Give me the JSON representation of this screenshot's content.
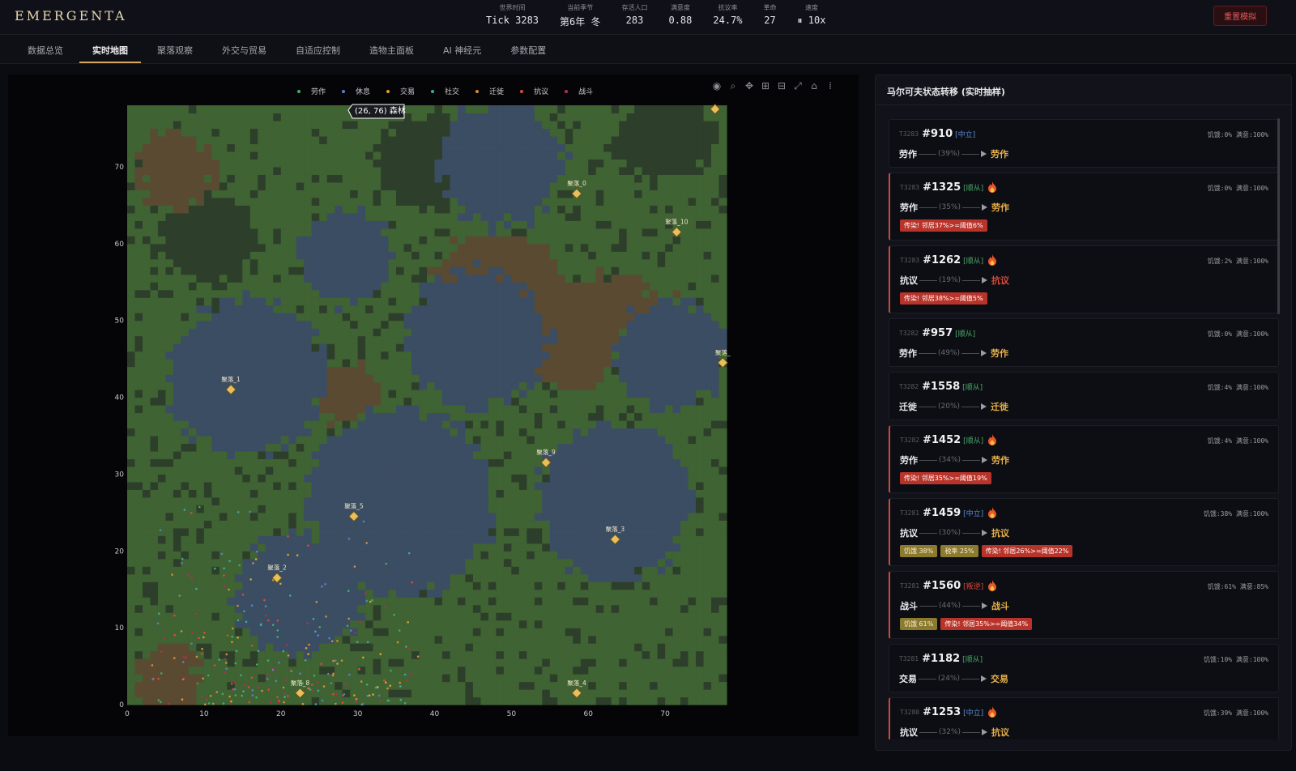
{
  "app": {
    "title": "EMERGENTA",
    "reset_label": "重置模拟"
  },
  "stats": [
    {
      "label": "世界时间",
      "value": "Tick 3283"
    },
    {
      "label": "当前季节",
      "value": "第6年 冬"
    },
    {
      "label": "存活人口",
      "value": "283"
    },
    {
      "label": "满意度",
      "value": "0.88"
    },
    {
      "label": "抗议率",
      "value": "24.7%"
    },
    {
      "label": "革命",
      "value": "27"
    },
    {
      "label": "速度",
      "value": "⏸ 10x"
    }
  ],
  "tabs": [
    {
      "label": "数据总览",
      "active": false
    },
    {
      "label": "实时地图",
      "active": true
    },
    {
      "label": "聚落观察",
      "active": false
    },
    {
      "label": "外交与贸易",
      "active": false
    },
    {
      "label": "自适应控制",
      "active": false
    },
    {
      "label": "造物主面板",
      "active": false
    },
    {
      "label": "AI 神经元",
      "active": false
    },
    {
      "label": "参数配置",
      "active": false
    }
  ],
  "legend": [
    {
      "label": "劳作",
      "color": "#3fae6a"
    },
    {
      "label": "休息",
      "color": "#5a7fc8"
    },
    {
      "label": "交易",
      "color": "#e0a030"
    },
    {
      "label": "社交",
      "color": "#3fa8a0"
    },
    {
      "label": "迁徙",
      "color": "#d88a3a"
    },
    {
      "label": "抗议",
      "color": "#d84a3a"
    },
    {
      "label": "战斗",
      "color": "#b03050"
    }
  ],
  "toolbar_icons": [
    "camera-icon",
    "zoom-icon",
    "pan-icon",
    "zoom-in-icon",
    "zoom-out-icon",
    "autoscale-icon",
    "reset-axes-icon",
    "plotly-logo-icon"
  ],
  "map": {
    "tooltip": "(26, 76) 森林",
    "x_ticks": [
      "0",
      "10",
      "20",
      "30",
      "40",
      "50",
      "60",
      "70"
    ],
    "y_ticks": [
      "0",
      "10",
      "20",
      "30",
      "40",
      "50",
      "60",
      "70"
    ],
    "colors": {
      "forest": "#3f6332",
      "water": "#3b4d63",
      "mountain": "#5a4a32",
      "dark": "#2d3f2a",
      "settlement": "#e8c05a"
    }
  },
  "chart_data": {
    "type": "scatter",
    "xlim": [
      0,
      78
    ],
    "ylim": [
      0,
      78
    ],
    "grid": false,
    "legend_position": "top",
    "x_ticks": [
      0,
      10,
      20,
      30,
      40,
      50,
      60,
      70
    ],
    "y_ticks": [
      0,
      10,
      20,
      30,
      40,
      50,
      60,
      70
    ],
    "series": [
      {
        "name": "聚落",
        "points": [
          {
            "label": "聚落_0",
            "x": 58.5,
            "y": 66.5
          },
          {
            "label": "聚落_1",
            "x": 13.5,
            "y": 41
          },
          {
            "label": "聚落_2",
            "x": 19.5,
            "y": 16.5
          },
          {
            "label": "聚落_3",
            "x": 63.5,
            "y": 21.5
          },
          {
            "label": "聚落_4",
            "x": 58.5,
            "y": 1.5
          },
          {
            "label": "聚落_5",
            "x": 29.5,
            "y": 24.5
          },
          {
            "label": "聚落_8",
            "x": 22.5,
            "y": 1.5
          },
          {
            "label": "聚落_9",
            "x": 54.5,
            "y": 31.5
          },
          {
            "label": "聚落_10",
            "x": 71.5,
            "y": 61.5
          },
          {
            "label": "聚落_",
            "x": 77.5,
            "y": 44.5
          },
          {
            "label": "",
            "x": 76.5,
            "y": 77.5
          }
        ]
      }
    ]
  },
  "panel": {
    "title": "马尔可夫状态转移 (实时抽样)"
  },
  "transitions": [
    {
      "tick": "T3283",
      "id": "#910",
      "alignment": "[中立]",
      "align_color": "#5b8fd9",
      "fire": false,
      "status": "饥饿:0% 满意:100%",
      "from": "劳作",
      "pct": "(39%)",
      "to": "劳作",
      "to_color": "#e8b04a",
      "tags": []
    },
    {
      "tick": "T3283",
      "id": "#1325",
      "alignment": "[顺从]",
      "align_color": "#4aa86a",
      "fire": true,
      "status": "饥饿:0% 满意:100%",
      "from": "劳作",
      "pct": "(35%)",
      "to": "劳作",
      "to_color": "#e8b04a",
      "tags": [
        {
          "text": "传染! 邻居37%>=阈值6%",
          "kind": "red"
        }
      ]
    },
    {
      "tick": "T3283",
      "id": "#1262",
      "alignment": "[顺从]",
      "align_color": "#4aa86a",
      "fire": true,
      "status": "饥饿:2% 满意:100%",
      "from": "抗议",
      "pct": "(19%)",
      "to": "抗议",
      "to_color": "#d84a3a",
      "tags": [
        {
          "text": "传染! 邻居38%>=阈值5%",
          "kind": "red"
        }
      ]
    },
    {
      "tick": "T3282",
      "id": "#957",
      "alignment": "[顺从]",
      "align_color": "#4aa86a",
      "fire": false,
      "status": "饥饿:0% 满意:100%",
      "from": "劳作",
      "pct": "(49%)",
      "to": "劳作",
      "to_color": "#e8b04a",
      "tags": []
    },
    {
      "tick": "T3282",
      "id": "#1558",
      "alignment": "[顺从]",
      "align_color": "#4aa86a",
      "fire": false,
      "status": "饥饿:4% 满意:100%",
      "from": "迁徙",
      "pct": "(20%)",
      "to": "迁徙",
      "to_color": "#e8b04a",
      "tags": []
    },
    {
      "tick": "T3282",
      "id": "#1452",
      "alignment": "[顺从]",
      "align_color": "#4aa86a",
      "fire": true,
      "status": "饥饿:4% 满意:100%",
      "from": "劳作",
      "pct": "(34%)",
      "to": "劳作",
      "to_color": "#e8b04a",
      "tags": [
        {
          "text": "传染! 邻居35%>=阈值19%",
          "kind": "red"
        }
      ]
    },
    {
      "tick": "T3281",
      "id": "#1459",
      "alignment": "[中立]",
      "align_color": "#5b8fd9",
      "fire": true,
      "status": "饥饿:38% 满意:100%",
      "from": "抗议",
      "pct": "(30%)",
      "to": "抗议",
      "to_color": "#e8b04a",
      "tags": [
        {
          "text": "饥饿 38%",
          "kind": "olive"
        },
        {
          "text": "税率 25%",
          "kind": "olive"
        },
        {
          "text": "传染! 邻居26%>=阈值22%",
          "kind": "red"
        }
      ]
    },
    {
      "tick": "T3281",
      "id": "#1560",
      "alignment": "[叛逆]",
      "align_color": "#d84a3a",
      "fire": true,
      "status": "饥饿:61% 满意:85%",
      "from": "战斗",
      "pct": "(44%)",
      "to": "战斗",
      "to_color": "#e8b04a",
      "tags": [
        {
          "text": "饥饿 61%",
          "kind": "olive"
        },
        {
          "text": "传染! 邻居35%>=阈值34%",
          "kind": "red"
        }
      ]
    },
    {
      "tick": "T3281",
      "id": "#1182",
      "alignment": "[顺从]",
      "align_color": "#4aa86a",
      "fire": false,
      "status": "饥饿:10% 满意:100%",
      "from": "交易",
      "pct": "(24%)",
      "to": "交易",
      "to_color": "#e8b04a",
      "tags": []
    },
    {
      "tick": "T3280",
      "id": "#1253",
      "alignment": "[中立]",
      "align_color": "#5b8fd9",
      "fire": true,
      "status": "饥饿:39% 满意:100%",
      "from": "抗议",
      "pct": "(32%)",
      "to": "抗议",
      "to_color": "#e8b04a",
      "tags": []
    }
  ]
}
